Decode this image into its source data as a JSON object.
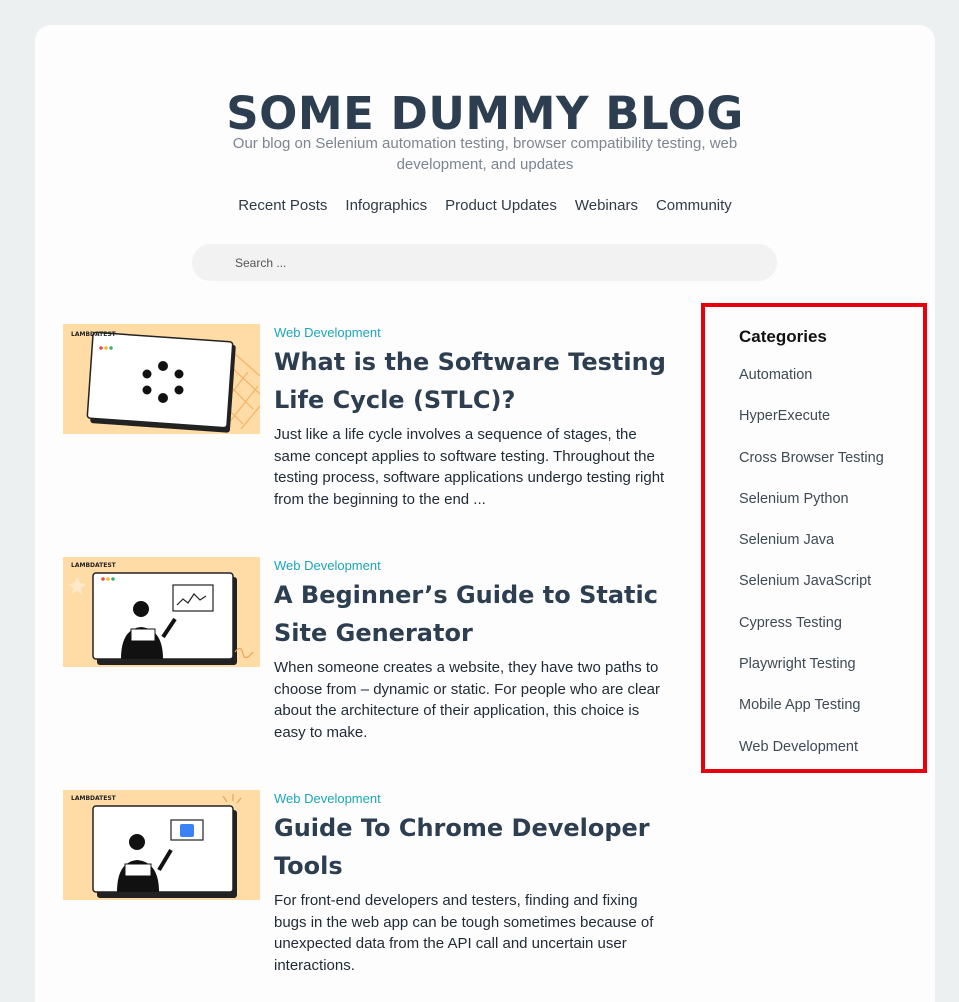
{
  "site": {
    "title": "SOME DUMMY BLOG",
    "tagline": "Our blog on Selenium automation testing, browser compatibility testing, web development, and updates"
  },
  "nav": [
    "Recent Posts",
    "Infographics",
    "Product Updates",
    "Webinars",
    "Community"
  ],
  "search": {
    "placeholder": "Search ..."
  },
  "posts": [
    {
      "category": "Web Development",
      "title": "What is the Software Testing Life Cycle (STLC)?",
      "excerpt": "Just like a life cycle involves a sequence of stages, the same concept applies to software testing. Throughout the testing process, software applications undergo testing right from the beginning to the end ...",
      "thumb_brand": "LAMBDATEST"
    },
    {
      "category": "Web Development",
      "title": "A Beginner’s Guide to Static Site Generator",
      "excerpt": "When someone creates a website, they have two paths to choose from – dynamic or static. For people who are clear about the architecture of their application, this choice is easy to make.",
      "thumb_brand": "LAMBDATEST"
    },
    {
      "category": "Web Development",
      "title": "Guide To Chrome Developer Tools",
      "excerpt": "For front-end developers and testers, finding and fixing bugs in the web app can be tough sometimes because of unexpected data from the API call and uncertain user interactions.",
      "thumb_brand": "LAMBDATEST"
    }
  ],
  "sidebar": {
    "heading": "Categories",
    "categories": [
      "Automation",
      "HyperExecute",
      "Cross Browser Testing",
      "Selenium Python",
      "Selenium Java",
      "Selenium JavaScript",
      "Cypress Testing",
      "Playwright Testing",
      "Mobile App Testing",
      "Web Development"
    ]
  },
  "colors": {
    "accent_teal": "#1ba6b5",
    "highlight_red": "#e8000f",
    "title_navy": "#2c3e50",
    "thumb_bg": "#ffdba6"
  }
}
